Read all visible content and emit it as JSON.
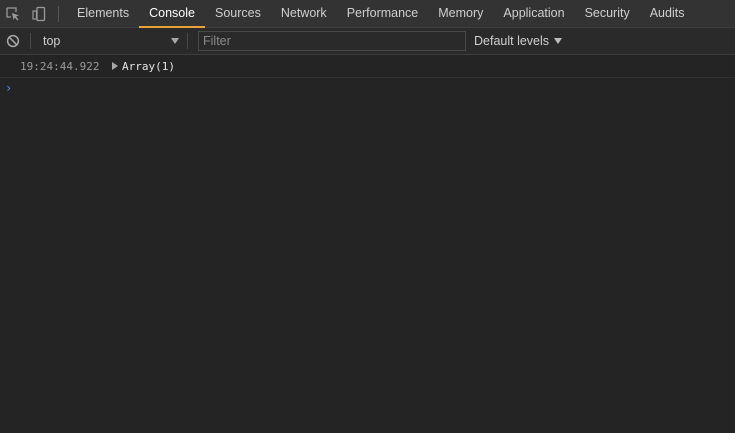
{
  "tabbar": {
    "tabs": [
      {
        "label": "Elements"
      },
      {
        "label": "Console"
      },
      {
        "label": "Sources"
      },
      {
        "label": "Network"
      },
      {
        "label": "Performance"
      },
      {
        "label": "Memory"
      },
      {
        "label": "Application"
      },
      {
        "label": "Security"
      },
      {
        "label": "Audits"
      }
    ],
    "active_tab": "Console",
    "icons": [
      "inspect-element-icon",
      "device-toolbar-icon"
    ],
    "accent_color": "#e8a23a"
  },
  "toolbar": {
    "clear_icon": "clear-console-icon",
    "context": "top",
    "filter_placeholder": "Filter",
    "levels_label": "Default levels"
  },
  "console": {
    "entries": [
      {
        "timestamp": "19:24:44.922",
        "preview": "Array(1)"
      }
    ],
    "prompt_symbol": "›",
    "prompt_color": "#4d90fe"
  }
}
